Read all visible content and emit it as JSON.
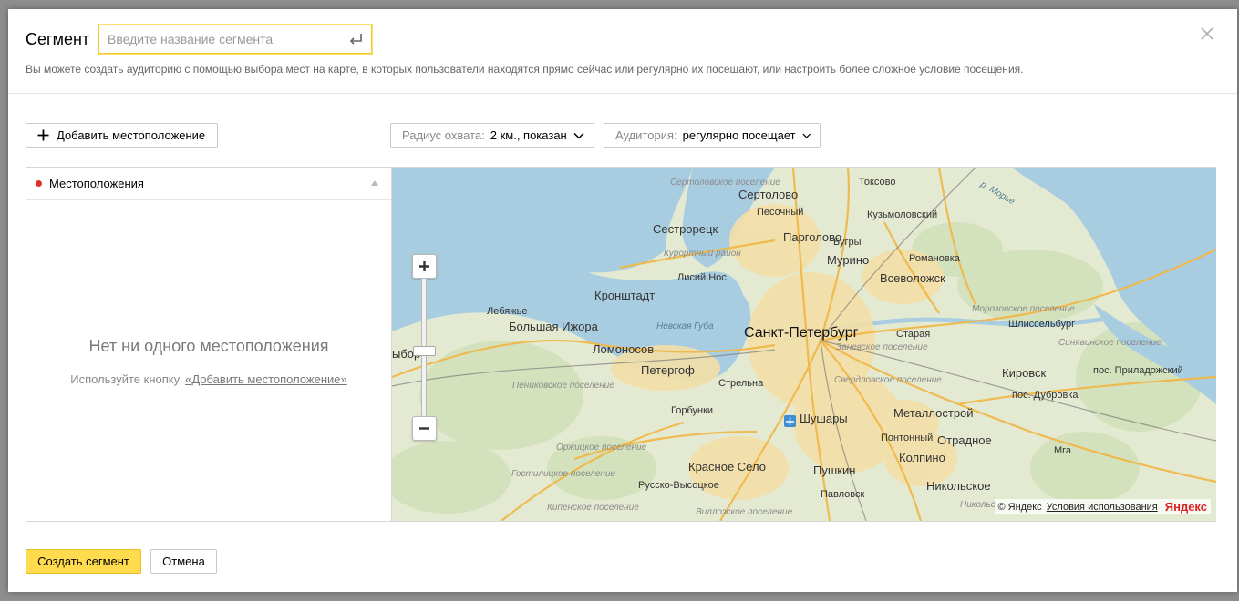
{
  "header": {
    "title": "Сегмент",
    "name_placeholder": "Введите название сегмента",
    "hint": "Вы можете создать аудиторию с помощью выбора мест на карте, в которых пользователи находятся прямо сейчас или регулярно их посещают, или настроить более сложное условие посещения."
  },
  "toolbar": {
    "add_location_label": "Добавить местоположение",
    "radius_label": "Радиус охвата:",
    "radius_value": "2 км., показан",
    "audience_label": "Аудитория:",
    "audience_value": "регулярно посещает"
  },
  "locations": {
    "header": "Местоположения",
    "empty_title": "Нет ни одного местоположения",
    "empty_hint": "Используйте кнопку",
    "empty_link": "«Добавить местоположение»"
  },
  "map": {
    "copyright": "© Яндекс",
    "terms_link": "Условия использования",
    "logo": "Яндекс",
    "labels": {
      "toksovo": "Токсово",
      "sertolovo": "Сертолово",
      "vertolovskoe": "Сертоловское поселение",
      "pesochny": "Песочный",
      "sestroretsk": "Сестрорецк",
      "pargolovo": "Парголово",
      "bugry": "Бугры",
      "kuzmolovsky": "Кузьмоловский",
      "kurortny": "Курортный район",
      "murino": "Мурино",
      "romanovka": "Романовка",
      "lisiy_nos": "Лисий Нос",
      "vsevolozhsk": "Всеволожск",
      "kronshtadt": "Кронштадт",
      "lebyazhye": "Лебяжье",
      "morozovskoe": "Морозовское поселение",
      "bolshaya_izhora": "Большая Ижора",
      "nevskaya_guba": "Невская Губа",
      "spb": "Санкт-Петербург",
      "staraya": "Старая",
      "shlisselburg": "Шлиссельбург",
      "lomonosov": "Ломоносов",
      "zanevskoe": "Заневское поселение",
      "sinyavinskoe": "Синявинское поселение",
      "vyborg_part": "ыборг",
      "peterhof": "Петергоф",
      "sverdlovskoe": "Свердловское поселение",
      "kirovsk": "Кировск",
      "prid": "пос. Приладожский",
      "penikovskoe": "Пениковское поселение",
      "strelna": "Стрельна",
      "dubrovka": "пос. Дубровка",
      "gorbunki": "Горбунки",
      "shushary": "Шушары",
      "metallostroy": "Металлострой",
      "pontonny": "Понтонный",
      "otradnoe": "Отрадное",
      "orzhitskoe": "Оржицкое поселение",
      "kolpino": "Колпино",
      "mga": "Мга",
      "krasnoe_selo": "Красное Село",
      "pushkin": "Пушкин",
      "gostilitskoe": "Гостилицкое поселение",
      "russko_vysotskoe": "Русско-Высоцкое",
      "nikolskoe": "Никольское",
      "pavlovsk": "Павловск",
      "kipenskoe": "Кипенское поселение",
      "vilozskoe": "Виллозское поселение",
      "nikolsk2": "Никольс",
      "r_morye": "р. Морье"
    }
  },
  "footer": {
    "create_label": "Создать сегмент",
    "cancel_label": "Отмена"
  },
  "colors": {
    "accent": "#ffdb4d",
    "water": "#a9cde0",
    "city": "#f4dfa8",
    "road": "#f2b843"
  }
}
